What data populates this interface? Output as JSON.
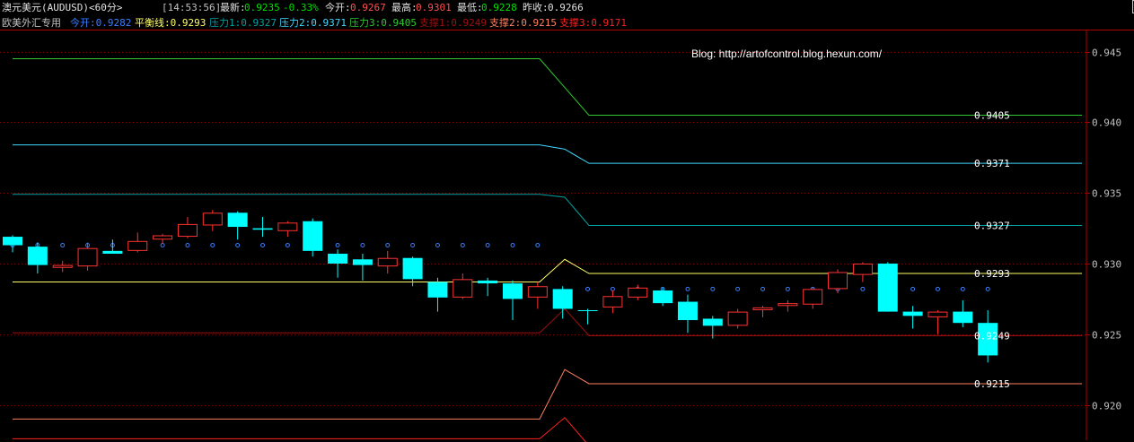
{
  "header": {
    "instrument": "澳元美元(AUDUSD)<60分>",
    "time": "[14:53:56]",
    "latest_label": "最新:",
    "latest_value": "0.9235",
    "change": "-0.33%",
    "open_label": "今开:",
    "open_value": "0.9267",
    "high_label": "最高:",
    "high_value": "0.9301",
    "low_label": "最低:",
    "low_value": "0.9228",
    "prev_label": "昨收:",
    "prev_value": "0.9266"
  },
  "indicator_bar": {
    "name": "欧美外汇专用",
    "items": [
      {
        "text": "今开:0.9282"
      },
      {
        "text": "平衡线:0.9293"
      },
      {
        "text": "压力1:0.9327"
      },
      {
        "text": "压力2:0.9371"
      },
      {
        "text": "压力3:0.9405"
      },
      {
        "text": "支撑1:0.9249"
      },
      {
        "text": "支撑2:0.9215"
      },
      {
        "text": "支撑3:0.9171"
      }
    ]
  },
  "window_controls": {
    "prev_icon": "⇦",
    "next_icon": "⇨"
  },
  "colors": {
    "up": "#ff3232",
    "down": "#00ffff",
    "grid": "#8a0000",
    "open_dots": "#3a7fff",
    "balance": "#ffff66",
    "r1": "#00a0a0",
    "r2": "#40d8ff",
    "r3": "#30c830",
    "s1": "#a01010",
    "s2": "#ff8060",
    "s3": "#ff2020"
  },
  "chart_data": {
    "type": "candlestick",
    "annotation": "Blog: http://artofcontrol.blog.hexun.com/",
    "ylim": [
      0.9175,
      0.9465
    ],
    "y_ticks": [
      "0.945",
      "0.940",
      "0.935",
      "0.930",
      "0.925",
      "0.920"
    ],
    "candles": [
      {
        "o": 0.9319,
        "h": 0.932,
        "l": 0.9308,
        "c": 0.9313
      },
      {
        "o": 0.9312,
        "h": 0.9315,
        "l": 0.9293,
        "c": 0.9299
      },
      {
        "o": 0.9297,
        "h": 0.9302,
        "l": 0.9294,
        "c": 0.9299
      },
      {
        "o": 0.9298,
        "h": 0.9315,
        "l": 0.9295,
        "c": 0.9311
      },
      {
        "o": 0.9309,
        "h": 0.9317,
        "l": 0.9307,
        "c": 0.9307
      },
      {
        "o": 0.9309,
        "h": 0.9322,
        "l": 0.9308,
        "c": 0.9316
      },
      {
        "o": 0.9317,
        "h": 0.9321,
        "l": 0.9314,
        "c": 0.932
      },
      {
        "o": 0.9319,
        "h": 0.9333,
        "l": 0.9318,
        "c": 0.9328
      },
      {
        "o": 0.9327,
        "h": 0.9338,
        "l": 0.9323,
        "c": 0.9336
      },
      {
        "o": 0.9336,
        "h": 0.9337,
        "l": 0.9317,
        "c": 0.9326
      },
      {
        "o": 0.9325,
        "h": 0.9333,
        "l": 0.9319,
        "c": 0.9324
      },
      {
        "o": 0.9323,
        "h": 0.933,
        "l": 0.9319,
        "c": 0.9329
      },
      {
        "o": 0.933,
        "h": 0.9332,
        "l": 0.9305,
        "c": 0.9309
      },
      {
        "o": 0.9307,
        "h": 0.931,
        "l": 0.929,
        "c": 0.93
      },
      {
        "o": 0.9303,
        "h": 0.9307,
        "l": 0.9288,
        "c": 0.9299
      },
      {
        "o": 0.9298,
        "h": 0.9309,
        "l": 0.9293,
        "c": 0.9304
      },
      {
        "o": 0.9304,
        "h": 0.9305,
        "l": 0.9284,
        "c": 0.9289
      },
      {
        "o": 0.9287,
        "h": 0.929,
        "l": 0.9266,
        "c": 0.9276
      },
      {
        "o": 0.9276,
        "h": 0.9293,
        "l": 0.9275,
        "c": 0.9289
      },
      {
        "o": 0.9288,
        "h": 0.929,
        "l": 0.9277,
        "c": 0.9286
      },
      {
        "o": 0.9286,
        "h": 0.9288,
        "l": 0.926,
        "c": 0.9275
      },
      {
        "o": 0.9276,
        "h": 0.9287,
        "l": 0.9268,
        "c": 0.9284
      },
      {
        "o": 0.9282,
        "h": 0.9284,
        "l": 0.9261,
        "c": 0.9268
      },
      {
        "o": 0.9267,
        "h": 0.9268,
        "l": 0.9257,
        "c": 0.9267
      },
      {
        "o": 0.9269,
        "h": 0.9281,
        "l": 0.9265,
        "c": 0.9277
      },
      {
        "o": 0.9276,
        "h": 0.9285,
        "l": 0.9274,
        "c": 0.9283
      },
      {
        "o": 0.9281,
        "h": 0.9283,
        "l": 0.927,
        "c": 0.9272
      },
      {
        "o": 0.9273,
        "h": 0.9278,
        "l": 0.9251,
        "c": 0.926
      },
      {
        "o": 0.9261,
        "h": 0.9263,
        "l": 0.9247,
        "c": 0.9256
      },
      {
        "o": 0.9256,
        "h": 0.9268,
        "l": 0.9254,
        "c": 0.9266
      },
      {
        "o": 0.9267,
        "h": 0.927,
        "l": 0.9262,
        "c": 0.9269
      },
      {
        "o": 0.927,
        "h": 0.9274,
        "l": 0.9266,
        "c": 0.9272
      },
      {
        "o": 0.9271,
        "h": 0.9283,
        "l": 0.9268,
        "c": 0.9282
      },
      {
        "o": 0.9282,
        "h": 0.9296,
        "l": 0.9279,
        "c": 0.9294
      },
      {
        "o": 0.9292,
        "h": 0.9301,
        "l": 0.9287,
        "c": 0.93
      },
      {
        "o": 0.93,
        "h": 0.9301,
        "l": 0.9266,
        "c": 0.9266
      },
      {
        "o": 0.9266,
        "h": 0.927,
        "l": 0.9254,
        "c": 0.9263
      },
      {
        "o": 0.9262,
        "h": 0.9267,
        "l": 0.925,
        "c": 0.9266
      },
      {
        "o": 0.9266,
        "h": 0.9274,
        "l": 0.9255,
        "c": 0.9258
      },
      {
        "o": 0.9258,
        "h": 0.9267,
        "l": 0.923,
        "c": 0.9235
      }
    ],
    "open_dots": [
      0.9313,
      0.9313,
      0.9313,
      0.9313,
      0.9313,
      0.9313,
      0.9313,
      0.9313,
      0.9313,
      0.9313,
      0.9313,
      0.9313,
      0.9313,
      0.9313,
      0.9313,
      0.9313,
      0.9313,
      0.9313,
      0.9313,
      0.9313,
      0.9313,
      0.9313,
      null,
      0.9282,
      0.9282,
      0.9282,
      0.9282,
      0.9282,
      0.9282,
      0.9282,
      0.9282,
      0.9282,
      0.9282,
      0.9282,
      0.9282,
      0.9282,
      0.9282,
      0.9282,
      0.9282,
      0.9282
    ],
    "levels": [
      {
        "key": "r3",
        "label": "0.9405",
        "old": 0.9445,
        "new": 0.9405,
        "spike": null
      },
      {
        "key": "r2",
        "label": "0.9371",
        "old": 0.9384,
        "new": 0.9371,
        "spike": 0.9381
      },
      {
        "key": "r1",
        "label": "0.9327",
        "old": 0.9349,
        "new": 0.9327,
        "spike": 0.9347
      },
      {
        "key": "balance",
        "label": "0.9293",
        "old": 0.9287,
        "new": 0.9293,
        "spike": 0.9303
      },
      {
        "key": "s1",
        "label": "0.9249",
        "old": 0.9251,
        "new": 0.9249,
        "spike": 0.9268
      },
      {
        "key": "s2",
        "label": "0.9215",
        "old": 0.919,
        "new": 0.9215,
        "spike": 0.9225
      },
      {
        "key": "s3",
        "label": "0.9171",
        "old": 0.9176,
        "new": 0.9171,
        "spike": 0.9191
      }
    ],
    "s1_value_label": "0.9249"
  }
}
